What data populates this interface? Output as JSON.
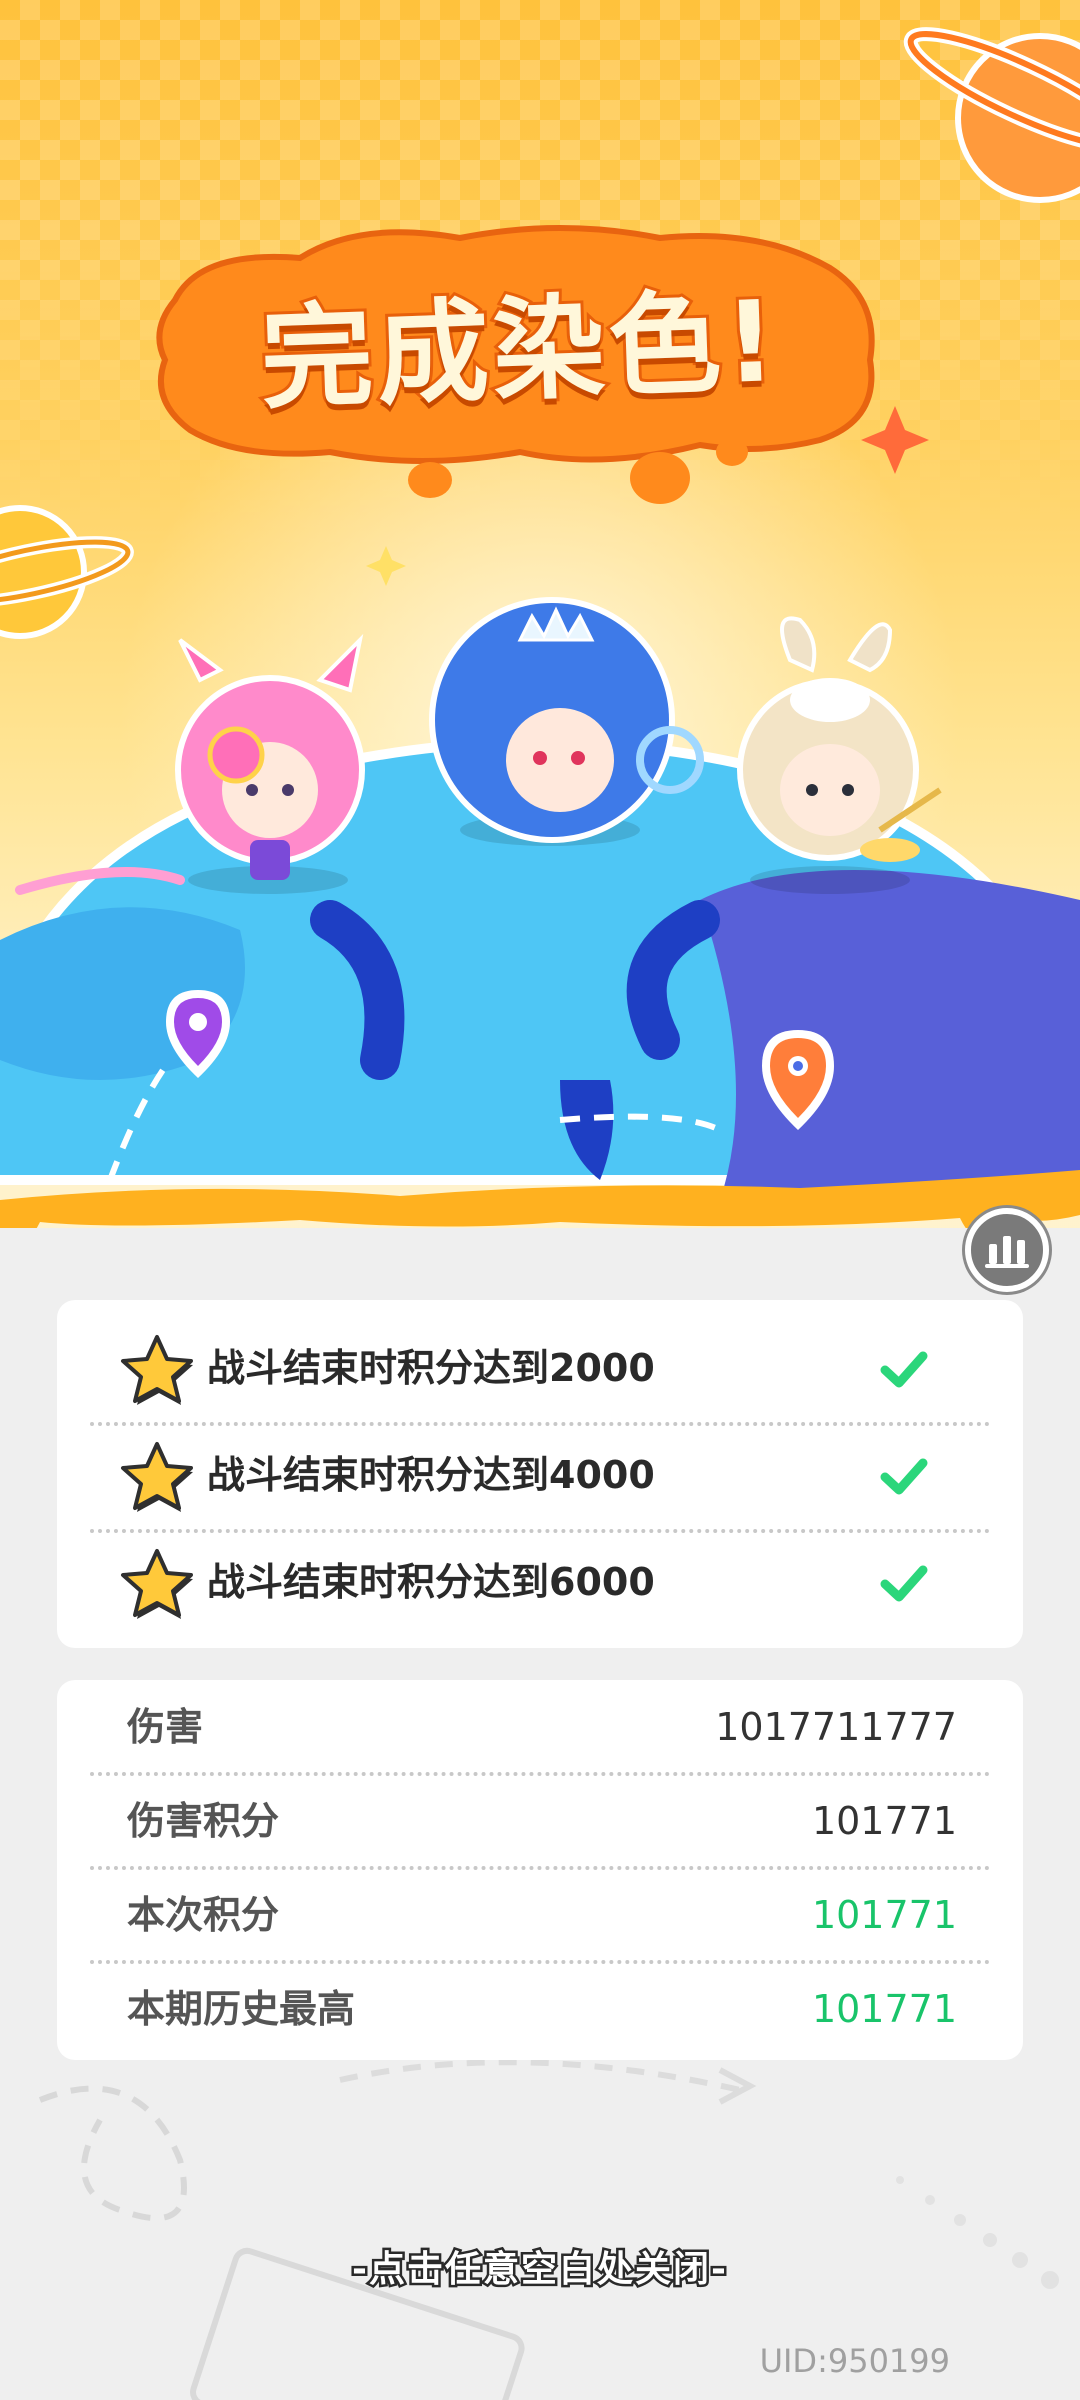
{
  "header": {
    "title": "完成染色!"
  },
  "tasks": [
    {
      "text": "战斗结束时积分达到2000",
      "completed": true
    },
    {
      "text": "战斗结束时积分达到4000",
      "completed": true
    },
    {
      "text": "战斗结束时积分达到6000",
      "completed": true
    }
  ],
  "stats": [
    {
      "label": "伤害",
      "value": "1017711777",
      "highlight": false
    },
    {
      "label": "伤害积分",
      "value": "101771",
      "highlight": false
    },
    {
      "label": "本次积分",
      "value": "101771",
      "highlight": true
    },
    {
      "label": "本期历史最高",
      "value": "101771",
      "highlight": true
    }
  ],
  "footer": {
    "close_hint": "-点击任意空白处关闭-",
    "uid": "UID:950199"
  },
  "icons": {
    "stats_button": "bar-chart-icon",
    "task_star": "star-icon",
    "task_done": "checkmark-icon"
  },
  "colors": {
    "accent_orange": "#f07a12",
    "check_green": "#2bd67b",
    "value_green": "#19c46a",
    "globe_blue": "#3aa8f0"
  }
}
